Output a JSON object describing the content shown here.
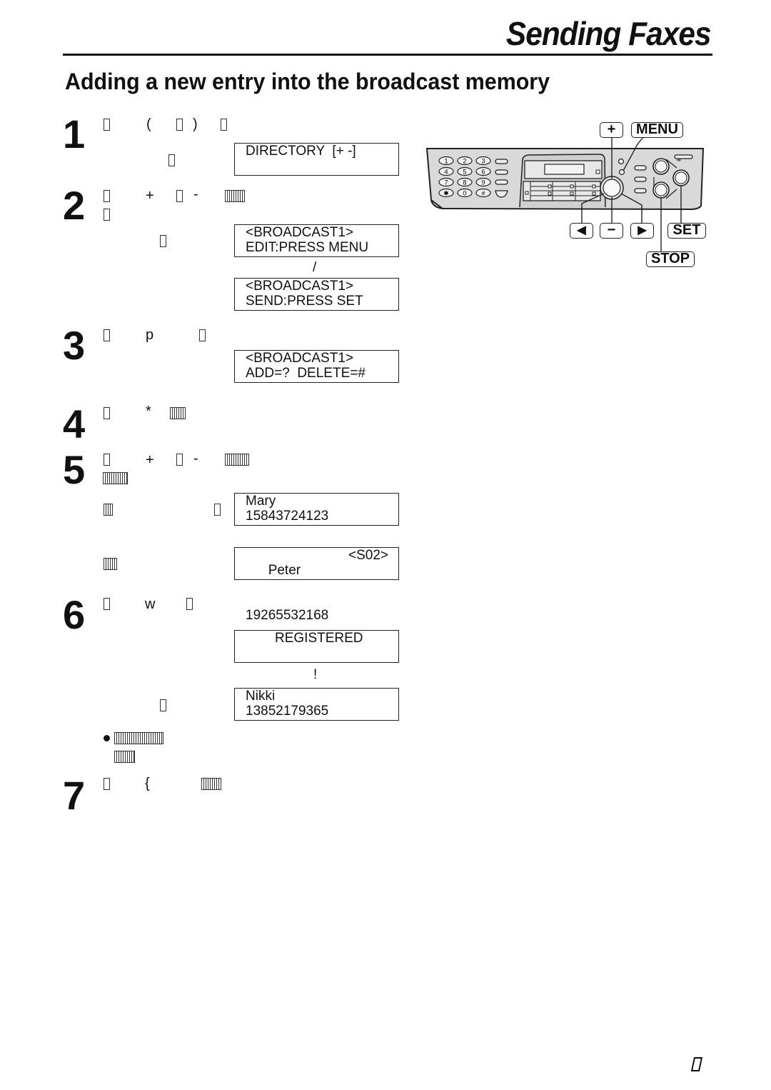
{
  "header": {
    "title": "Sending Faxes"
  },
  "section": {
    "title": "Adding a new entry into the broadcast memory"
  },
  "steps": [
    {
      "number": "1",
      "glyphs": [
        "(",
        ")"
      ]
    },
    {
      "number": "2",
      "glyphs": [
        "+",
        "-"
      ]
    },
    {
      "number": "3",
      "glyphs": [
        "p"
      ]
    },
    {
      "number": "4",
      "glyphs": [
        "*"
      ]
    },
    {
      "number": "5",
      "glyphs": [
        "+",
        "-"
      ]
    },
    {
      "number": "6",
      "glyphs": [
        "w"
      ]
    },
    {
      "number": "7",
      "glyphs": [
        "{"
      ]
    }
  ],
  "displays": {
    "directory": {
      "line1": "DIRECTORY  [+ -]",
      "line2": ""
    },
    "broadcast_edit": {
      "line1": "<BROADCAST1>",
      "line2": "EDIT:PRESS MENU"
    },
    "separator_1": "/",
    "broadcast_send": {
      "line1": "<BROADCAST1>",
      "line2": "SEND:PRESS SET"
    },
    "broadcast_add": {
      "line1": "<BROADCAST1>",
      "line2": "ADD=?  DELETE=#"
    },
    "mary": {
      "line1": "Mary",
      "line2": "15843724123"
    },
    "peter": {
      "line1": "Peter",
      "line1_right": "<S02>",
      "line2": "19265532168"
    },
    "registered": {
      "line1": "REGISTERED",
      "line2": ""
    },
    "separator_2": "!",
    "nikki": {
      "line1": "Nikki",
      "line2": "13852179365"
    }
  },
  "device": {
    "keys": {
      "plus": "+",
      "menu": "MENU",
      "left": "◀",
      "minus": "−",
      "right": "▶",
      "set": "SET",
      "stop": "STOP"
    },
    "dial_pad": [
      "1",
      "2",
      "3",
      "4",
      "5",
      "6",
      "7",
      "8",
      "9",
      "✱",
      "0",
      "#"
    ]
  }
}
